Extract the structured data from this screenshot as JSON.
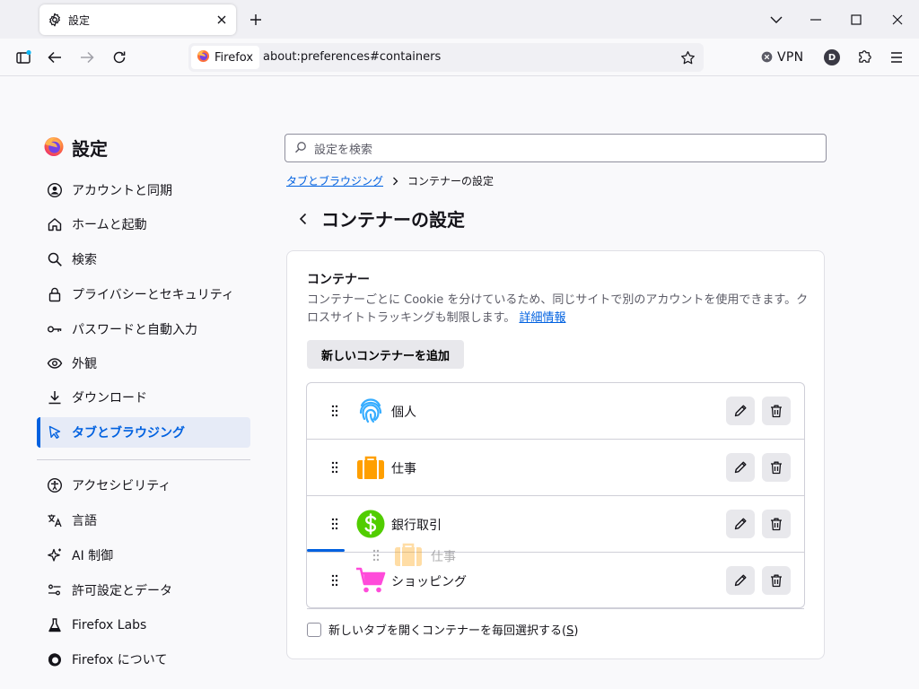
{
  "tab": {
    "title": "設定"
  },
  "navbar": {
    "identity_label": "Firefox",
    "url": "about:preferences#containers",
    "vpn_label": "VPN",
    "avatar_letter": "D"
  },
  "sidebar": {
    "title": "設定",
    "items": [
      {
        "label": "アカウントと同期",
        "icon": "account-icon"
      },
      {
        "label": "ホームと起動",
        "icon": "home-icon"
      },
      {
        "label": "検索",
        "icon": "search-icon"
      },
      {
        "label": "プライバシーとセキュリティ",
        "icon": "lock-icon"
      },
      {
        "label": "パスワードと自動入力",
        "icon": "key-icon"
      },
      {
        "label": "外観",
        "icon": "eye-icon"
      },
      {
        "label": "ダウンロード",
        "icon": "download-icon"
      },
      {
        "label": "タブとブラウジング",
        "icon": "cursor-icon",
        "active": true
      },
      {
        "label": "アクセシビリティ",
        "icon": "accessibility-icon"
      },
      {
        "label": "言語",
        "icon": "translate-icon"
      },
      {
        "label": "AI 制御",
        "icon": "sparkle-icon"
      },
      {
        "label": "許可設定とデータ",
        "icon": "sliders-icon"
      },
      {
        "label": "Firefox Labs",
        "icon": "flask-icon"
      },
      {
        "label": "Firefox について",
        "icon": "firefox-logo-icon"
      }
    ]
  },
  "search": {
    "placeholder": "設定を検索"
  },
  "breadcrumb": {
    "parent": "タブとブラウジング",
    "current": "コンテナーの設定"
  },
  "page_title": "コンテナーの設定",
  "containers": {
    "title": "コンテナー",
    "description": "コンテナーごとに Cookie を分けているため、同じサイトで別のアカウントを使用できます。クロスサイトトラッキングも制限します。",
    "learn_more": "詳細情報",
    "add_button": "新しいコンテナーを追加",
    "list": [
      {
        "name": "個人",
        "icon": "fingerprint-icon",
        "color": "#37adff"
      },
      {
        "name": "仕事",
        "icon": "briefcase-icon",
        "color": "#ff9f00"
      },
      {
        "name": "銀行取引",
        "icon": "dollar-icon",
        "color": "#51cd00"
      },
      {
        "name": "ショッピング",
        "icon": "cart-icon",
        "color": "#ff4bda"
      }
    ],
    "dragging": {
      "name": "仕事"
    },
    "checkbox_label": "新しいタブを開くコンテナーを毎回選択する(",
    "checkbox_accesskey": "S",
    "checkbox_label_end": ")"
  },
  "colors": {
    "accent": "#0061e0",
    "active_bg": "#e6ebf7"
  }
}
